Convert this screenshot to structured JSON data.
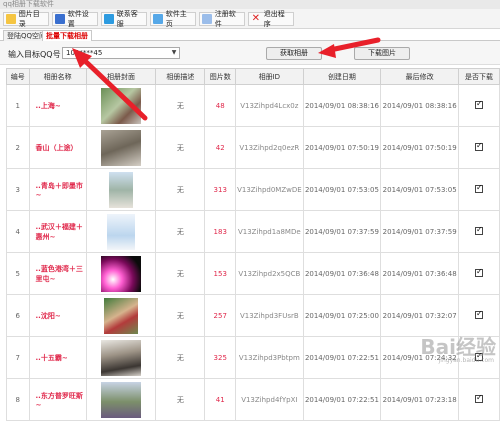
{
  "window": {
    "title": "qq相册下载软件"
  },
  "toolbar": {
    "items": [
      {
        "label": "图片目录",
        "icon": "folder-icon"
      },
      {
        "label": "软件设置",
        "icon": "settings-icon"
      },
      {
        "label": "联系客服",
        "icon": "contact-icon"
      },
      {
        "label": "软件主页",
        "icon": "home-icon"
      },
      {
        "label": "注册软件",
        "icon": "register-icon"
      },
      {
        "label": "退出程序",
        "icon": "close-icon"
      }
    ]
  },
  "tabs": [
    {
      "label": "登陆QQ空间"
    },
    {
      "label": "批量下载相册"
    }
  ],
  "search": {
    "label": "输入目标QQ号",
    "value": "100****45"
  },
  "buttons": {
    "get_albums": "获取相册",
    "download": "下载图片"
  },
  "table": {
    "headers": [
      "编号",
      "相册名称",
      "相册封面",
      "相册描述",
      "图片数",
      "相册ID",
      "创建日期",
      "最后修改",
      "是否下载"
    ],
    "rows": [
      {
        "no": "1",
        "name": "..上海~",
        "desc": "无",
        "count": "48",
        "id": "V13Zihpd4Lcx0z",
        "created": "2014/09/01 08:38:16",
        "modified": "2014/09/01 08:38:16"
      },
      {
        "no": "2",
        "name": "香山（上途）",
        "desc": "无",
        "count": "42",
        "id": "V13Zihpd2q0ezR",
        "created": "2014/09/01 07:50:19",
        "modified": "2014/09/01 07:50:19"
      },
      {
        "no": "3",
        "name": "..青岛＋即墨市~",
        "desc": "无",
        "count": "313",
        "id": "V13Zihpd0MZwDE",
        "created": "2014/09/01 07:53:05",
        "modified": "2014/09/01 07:53:05"
      },
      {
        "no": "4",
        "name": "..武汉＋福建＋惠州~",
        "desc": "无",
        "count": "183",
        "id": "V13Zihpd1a8MDe",
        "created": "2014/09/01 07:37:59",
        "modified": "2014/09/01 07:37:59"
      },
      {
        "no": "5",
        "name": "..蓝色港湾＋三里屯~",
        "desc": "无",
        "count": "153",
        "id": "V13Zihpd2x5QCB",
        "created": "2014/09/01 07:36:48",
        "modified": "2014/09/01 07:36:48"
      },
      {
        "no": "6",
        "name": "..沈阳~",
        "desc": "无",
        "count": "257",
        "id": "V13Zihpd3FUsrB",
        "created": "2014/09/01 07:25:00",
        "modified": "2014/09/01 07:32:07"
      },
      {
        "no": "7",
        "name": "..十五霸~",
        "desc": "无",
        "count": "325",
        "id": "V13Zihpd3Pbtpm",
        "created": "2014/09/01 07:22:51",
        "modified": "2014/09/01 07:24:32"
      },
      {
        "no": "8",
        "name": "..东方普罗旺斯~",
        "desc": "无",
        "count": "41",
        "id": "V13Zihpd4fYpXI",
        "created": "2014/09/01 07:22:51",
        "modified": "2014/09/01 07:23:18"
      }
    ]
  },
  "watermark": {
    "text": "Bai经验",
    "url": "jingyan.baidu.com"
  },
  "colors": {
    "accent_red": "#e0284b",
    "arrow_red": "#e8202a"
  }
}
